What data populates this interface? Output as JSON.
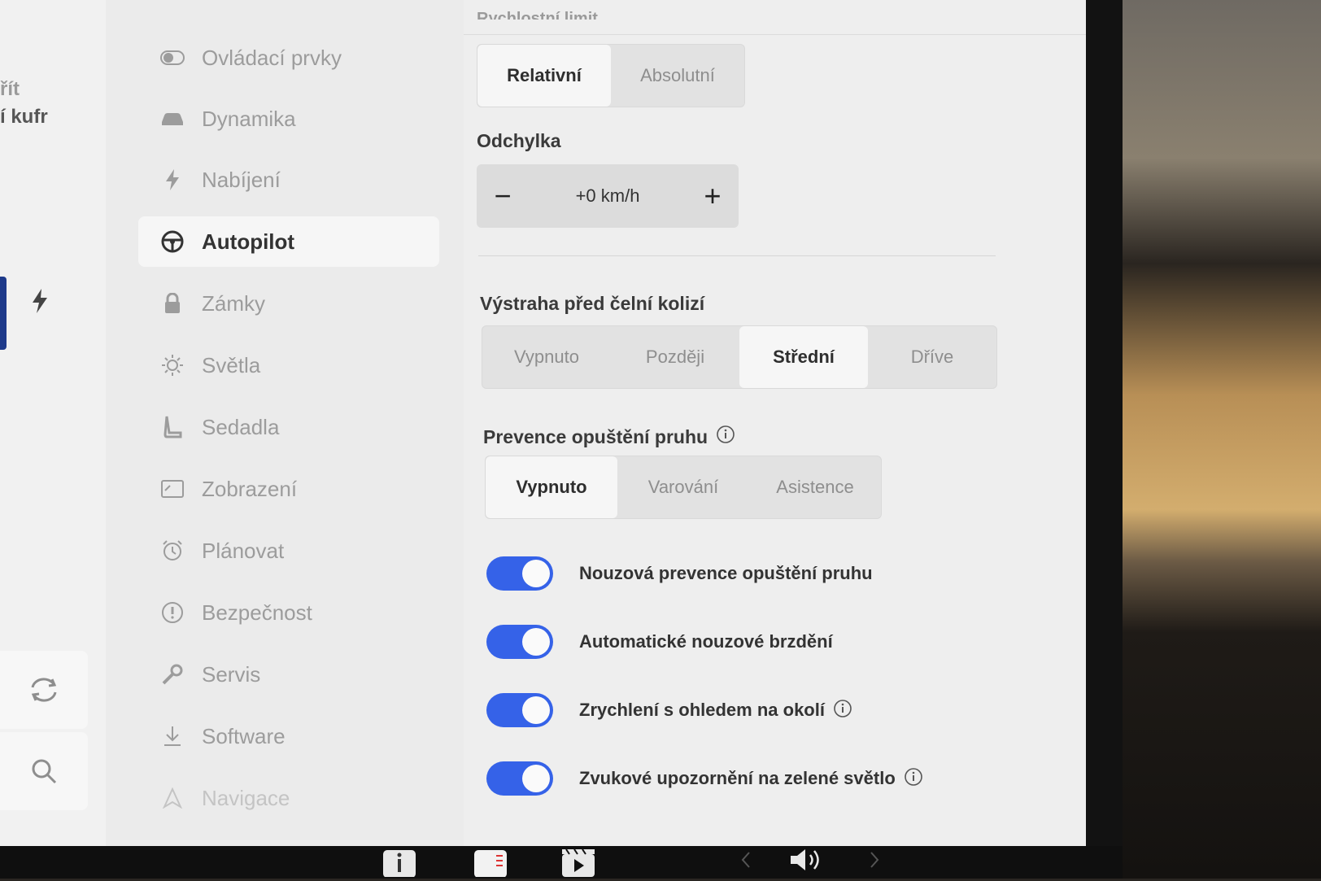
{
  "left_panel": {
    "partial_text_1": "řít",
    "partial_text_2": "í kufr"
  },
  "sidebar": {
    "items": [
      {
        "label": "Ovládací prvky",
        "icon": "toggle-icon",
        "active": false
      },
      {
        "label": "Dynamika",
        "icon": "car-icon",
        "active": false
      },
      {
        "label": "Nabíjení",
        "icon": "bolt-icon",
        "active": false
      },
      {
        "label": "Autopilot",
        "icon": "steering-wheel-icon",
        "active": true
      },
      {
        "label": "Zámky",
        "icon": "lock-icon",
        "active": false
      },
      {
        "label": "Světla",
        "icon": "sun-icon",
        "active": false
      },
      {
        "label": "Sedadla",
        "icon": "seat-icon",
        "active": false
      },
      {
        "label": "Zobrazení",
        "icon": "display-icon",
        "active": false
      },
      {
        "label": "Plánovat",
        "icon": "alarm-clock-icon",
        "active": false
      },
      {
        "label": "Bezpečnost",
        "icon": "alert-circle-icon",
        "active": false
      },
      {
        "label": "Servis",
        "icon": "wrench-icon",
        "active": false
      },
      {
        "label": "Software",
        "icon": "download-icon",
        "active": false
      },
      {
        "label": "Navigace",
        "icon": "navigation-icon",
        "active": false
      }
    ]
  },
  "content": {
    "speed_limit_mode": {
      "label": "Rychlostní limit",
      "options": [
        "Relativní",
        "Absolutní"
      ],
      "selected": "Relativní"
    },
    "offset": {
      "label": "Odchylka",
      "value": "+0 km/h",
      "minus": "−",
      "plus": "+"
    },
    "collision_warning": {
      "label": "Výstraha před čelní kolizí",
      "options": [
        "Vypnuto",
        "Později",
        "Střední",
        "Dříve"
      ],
      "selected": "Střední"
    },
    "lane_departure": {
      "label": "Prevence opuštění pruhu",
      "options": [
        "Vypnuto",
        "Varování",
        "Asistence"
      ],
      "selected": "Vypnuto"
    },
    "toggles": [
      {
        "label": "Nouzová prevence opuštění pruhu",
        "on": true,
        "info": false
      },
      {
        "label": "Automatické nouzové brzdění",
        "on": true,
        "info": false
      },
      {
        "label": "Zrychlení s ohledem na okolí",
        "on": true,
        "info": true
      },
      {
        "label": "Zvukové upozornění na zelené světlo",
        "on": true,
        "info": true
      }
    ]
  },
  "colors": {
    "toggle_on": "#3562e8",
    "background": "#eeeeee",
    "sidebar_active": "#f6f6f6"
  }
}
